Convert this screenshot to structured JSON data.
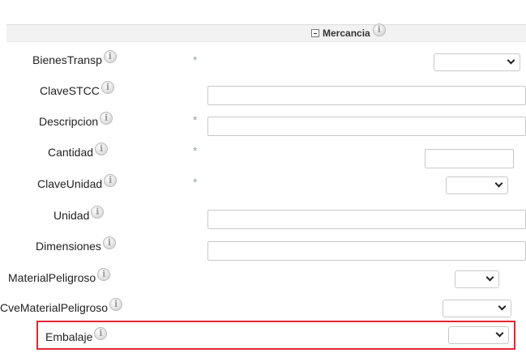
{
  "section": {
    "title": "Mercancia",
    "info_icon": "info-icon",
    "collapse_icon": "collapse-minus-icon"
  },
  "required_marker": "*",
  "fields": {
    "bienes_transp": {
      "label": "BienesTransp",
      "value": ""
    },
    "clave_stcc": {
      "label": "ClaveSTCC",
      "value": ""
    },
    "descripcion": {
      "label": "Descripcion",
      "value": ""
    },
    "cantidad": {
      "label": "Cantidad",
      "value": ""
    },
    "clave_unidad": {
      "label": "ClaveUnidad",
      "value": ""
    },
    "unidad": {
      "label": "Unidad",
      "value": ""
    },
    "dimensiones": {
      "label": "Dimensiones",
      "value": ""
    },
    "material_peligroso": {
      "label": "MaterialPeligroso",
      "value": ""
    },
    "cve_material_peligroso": {
      "label": "CveMaterialPeligroso",
      "value": ""
    },
    "embalaje": {
      "label": "Embalaje",
      "value": ""
    }
  },
  "colors": {
    "highlight": "#e32636",
    "header_bg": "#f2f2f2",
    "required": "#9aa3ad"
  }
}
